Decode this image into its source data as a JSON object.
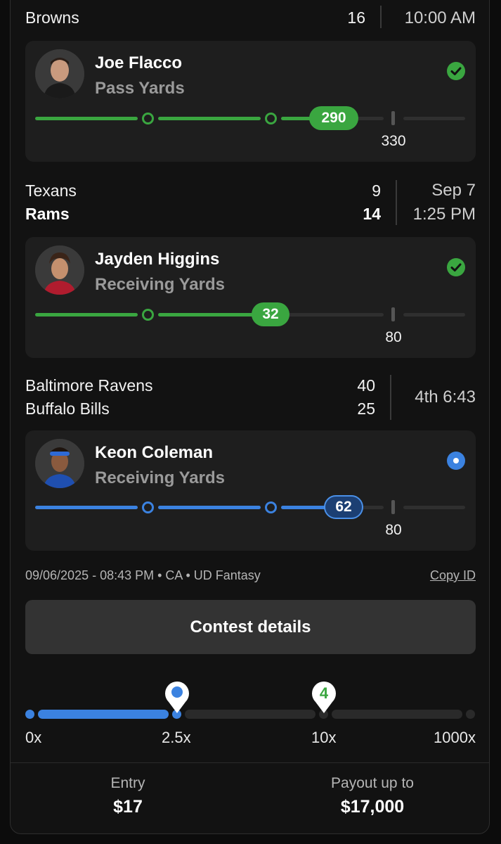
{
  "game1": {
    "team": "Browns",
    "score": "16",
    "time": "10:00 AM"
  },
  "pick1": {
    "player": "Joe Flacco",
    "stat": "Pass Yards",
    "value": "290",
    "target": "330",
    "status": "hit",
    "progress_pct": 88
  },
  "game2": {
    "teams": [
      {
        "name": "Texans",
        "score": "9",
        "winner": false
      },
      {
        "name": "Rams",
        "score": "14",
        "winner": true
      }
    ],
    "date": "Sep 7",
    "time": "1:25 PM"
  },
  "pick2": {
    "player": "Jayden Higgins",
    "stat": "Receiving Yards",
    "value": "32",
    "target": "80",
    "status": "hit",
    "progress_pct": 40
  },
  "game3": {
    "teams": [
      {
        "name": "Baltimore Ravens",
        "score": "40"
      },
      {
        "name": "Buffalo Bills",
        "score": "25"
      }
    ],
    "clock": "4th 6:43"
  },
  "pick3": {
    "player": "Keon Coleman",
    "stat": "Receiving Yards",
    "value": "62",
    "target": "80",
    "status": "live",
    "progress_pct": 78
  },
  "meta": {
    "text": "09/06/2025 - 08:43 PM • CA • UD Fantasy",
    "copy_id": "Copy ID"
  },
  "contest_button": "Contest details",
  "multiplier": {
    "labels": [
      "0x",
      "2.5x",
      "10x",
      "1000x"
    ],
    "current": "2.5x",
    "remaining_marker": "4"
  },
  "footer": {
    "entry_label": "Entry",
    "entry_value": "$17",
    "payout_label": "Payout up to",
    "payout_value": "$17,000"
  },
  "colors": {
    "green": "#3aa640",
    "blue": "#3b82e0",
    "track": "#2a2a2a"
  }
}
